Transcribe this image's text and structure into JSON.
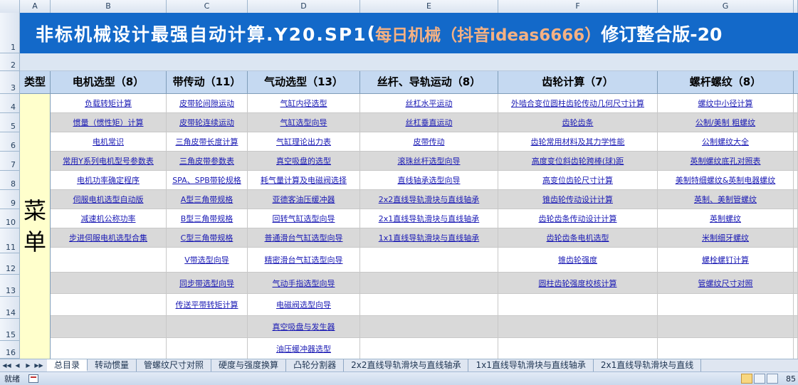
{
  "columns": [
    "A",
    "B",
    "C",
    "D",
    "E",
    "F",
    "G"
  ],
  "row_numbers": [
    "1",
    "2",
    "3",
    "4",
    "5",
    "6",
    "7",
    "8",
    "9",
    "10",
    "11",
    "12",
    "13",
    "14",
    "15",
    "16"
  ],
  "banner": {
    "main": "非标机械设计最强自动计算.Y20.SP1",
    "open": "(",
    "highlight": "每日机械（抖音ideas6666）",
    "tail": "修订整合版-20"
  },
  "type_header": "类型",
  "type_chars": [
    "菜",
    "单"
  ],
  "category_headers": [
    "电机选型（8）",
    "带传动（11）",
    "气动选型（13）",
    "丝杆、导轨运动（8）",
    "齿轮计算（7）",
    "螺杆螺纹（8）"
  ],
  "rows": [
    [
      "负载转矩计算",
      "皮带轮间隙运动",
      "气缸内径选型",
      "丝杠水平运动",
      "外啮合变位圆柱齿轮传动几何尺寸计算",
      "螺纹中小径计算"
    ],
    [
      "惯量（惯性矩）计算",
      "皮带轮连续运动",
      "气缸选型向导",
      "丝杠垂直运动",
      "齿轮齿条",
      "公制/美制 粗螺纹"
    ],
    [
      "电机常识",
      "三角皮带长度计算",
      "气缸理论出力表",
      "皮带传动",
      "齿轮常用材料及其力学性能",
      "公制螺纹大全"
    ],
    [
      "常用Y系列电机型号参数表",
      "三角皮带参数表",
      "真空吸盘的选型",
      "滚珠丝杆选型向导",
      "高度变位斜齿轮跨棒(球)距",
      "英制螺纹底孔对照表"
    ],
    [
      "电机功率确定程序",
      "SPA、SPB带轮规格",
      "耗气量计算及电磁阀选择",
      "直线轴承选型向导",
      "高变位齿轮尺寸计算",
      "美制特细螺纹&英制电器螺纹"
    ],
    [
      "伺服电机选型自动版",
      "A型三角带规格",
      "亚德客油压缓冲器",
      "2x2直线导轨滑块与直线轴承",
      "锥齿轮传动设计计算",
      "英制、美制管螺纹"
    ],
    [
      "减速机公称功率",
      "B型三角带规格",
      "回转气缸选型向导",
      "2x1直线导轨滑块与直线轴承",
      "齿轮齿条传动设计计算",
      "英制螺纹"
    ],
    [
      "步进伺服电机选型合集",
      "C型三角带规格",
      "普通滑台气缸选型向导",
      "1x1直线导轨滑块与直线轴承",
      "齿轮齿条电机选型",
      "米制细牙螺纹"
    ],
    [
      "",
      "V带选型向导",
      "精密滑台气缸选型向导",
      "",
      "锥齿轮强度",
      "螺栓螺钉计算"
    ],
    [
      "",
      "同步带选型向导",
      "气动手指选型向导",
      "",
      "圆柱齿轮强度校核计算",
      "管螺纹尺寸对照"
    ],
    [
      "",
      "传送平带转矩计算",
      "电磁阀选型向导",
      "",
      "",
      ""
    ],
    [
      "",
      "",
      "真空吸盘与发生器",
      "",
      "",
      ""
    ],
    [
      "",
      "",
      "油压缓冲器选型",
      "",
      "",
      ""
    ]
  ],
  "sheet_tabs": [
    "总目录",
    "转动惯量",
    "管螺纹尺寸对照",
    "硬度与强度换算",
    "凸轮分割器",
    "2x2直线导轨滑块与直线轴承",
    "1x1直线导轨滑块与直线轴承",
    "2x1直线导轨滑块与直线"
  ],
  "status": {
    "ready": "就绪",
    "zoom": "85"
  }
}
